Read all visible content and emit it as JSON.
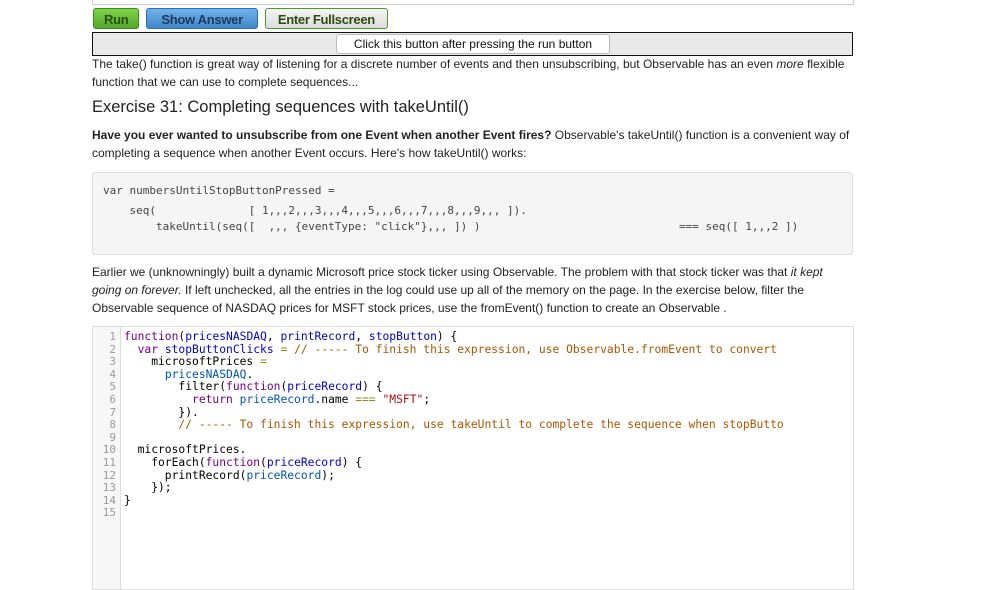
{
  "buttons": {
    "run": "Run",
    "show_answer": "Show Answer",
    "fullscreen": "Enter Fullscreen",
    "stop": "Click this button after pressing the run button"
  },
  "intro": {
    "text1": "The take() function is great way of listening for a discrete number of events and then unsubscribing, but Observable has an even ",
    "em": "more",
    "text2": " flexible function that we can use to complete sequences..."
  },
  "heading": "Exercise 31: Completing sequences with takeUntil()",
  "desc": {
    "bold": "Have you ever wanted to unsubscribe from one Event when another Event fires?",
    "rest": " Observable's takeUntil() function is a convenient way of completing a sequence when another Event occurs. Here's how takeUntil() works:"
  },
  "example": {
    "line1": "var numbersUntilStopButtonPressed =",
    "line2": "    seq(              [ 1,,,2,,,3,,,4,,,5,,,6,,,7,,,8,,,9,,, ]).",
    "line3": "        takeUntil(seq([  ,,, {eventType: \"click\"},,, ]) )",
    "result": "=== seq([ 1,,,2 ])"
  },
  "body": {
    "text1": "Earlier we (unknowningly) built a dynamic Microsoft price stock ticker using Observable. The problem with that stock ticker was that ",
    "em": "it kept going on forever.",
    "text2": " If left unchecked, all the entries in the log could use up all of the memory on the page. In the exercise below, filter the Observable sequence of NASDAQ prices for MSFT stock prices, use the fromEvent() function to create an Observable ."
  },
  "code": [
    [
      [
        "kw",
        "function"
      ],
      [
        "",
        "("
      ],
      [
        "df",
        "pricesNASDAQ"
      ],
      [
        "",
        ", "
      ],
      [
        "df",
        "printRecord"
      ],
      [
        "",
        ", "
      ],
      [
        "df",
        "stopButton"
      ],
      [
        "",
        ") {"
      ]
    ],
    [
      [
        "",
        "  "
      ],
      [
        "kw",
        "var"
      ],
      [
        "",
        "",
        " "
      ],
      [
        "df",
        "stopButtonClicks"
      ],
      [
        "op",
        " = "
      ],
      [
        "cm",
        "// ----- To finish this expression, use Observable.fromEvent to convert"
      ]
    ],
    [
      [
        "",
        "    microsoftPrices "
      ],
      [
        "op",
        "="
      ]
    ],
    [
      [
        "",
        "      "
      ],
      [
        "vr",
        "pricesNASDAQ"
      ],
      [
        "",
        "."
      ]
    ],
    [
      [
        "",
        "        filter("
      ],
      [
        "kw",
        "function"
      ],
      [
        "",
        "("
      ],
      [
        "df",
        "priceRecord"
      ],
      [
        "",
        ") {"
      ]
    ],
    [
      [
        "",
        "          "
      ],
      [
        "kw",
        "return"
      ],
      [
        "",
        "",
        " "
      ],
      [
        "vr",
        "priceRecord"
      ],
      [
        "",
        ".name "
      ],
      [
        "op",
        "==="
      ],
      [
        "",
        "",
        " "
      ],
      [
        "st",
        "\"MSFT\""
      ],
      [
        "",
        ";"
      ]
    ],
    [
      [
        "",
        "        })."
      ]
    ],
    [
      [
        "",
        "        "
      ],
      [
        "cm",
        "// ----- To finish this expression, use takeUntil to complete the sequence when stopButto"
      ]
    ],
    [],
    [
      [
        "",
        "  microsoftPrices."
      ]
    ],
    [
      [
        "",
        "    forEach("
      ],
      [
        "kw",
        "function"
      ],
      [
        "",
        "("
      ],
      [
        "df",
        "priceRecord"
      ],
      [
        "",
        ") {"
      ]
    ],
    [
      [
        "",
        "      printRecord("
      ],
      [
        "vr",
        "priceRecord"
      ],
      [
        "",
        ");"
      ]
    ],
    [
      [
        "",
        "    });"
      ]
    ],
    [
      [
        "",
        "}"
      ]
    ],
    []
  ]
}
